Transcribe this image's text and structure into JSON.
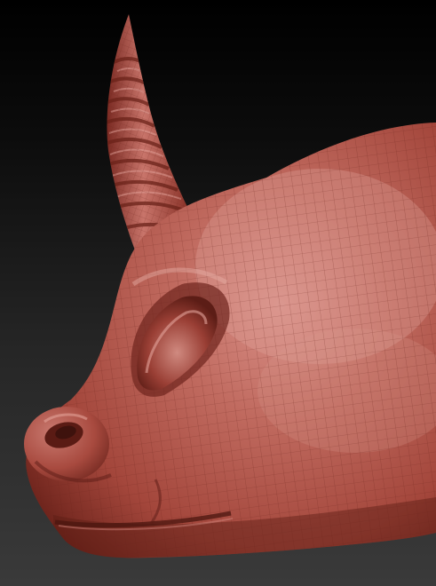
{
  "scene": {
    "subject": "sculpted-creature-head",
    "background_top": "#000000",
    "background_bottom": "#3a3a3a",
    "material_base": "#a8453a",
    "material_highlight": "#d88a80",
    "material_shadow": "#5a1c16",
    "wire_color": "#6a231c"
  }
}
